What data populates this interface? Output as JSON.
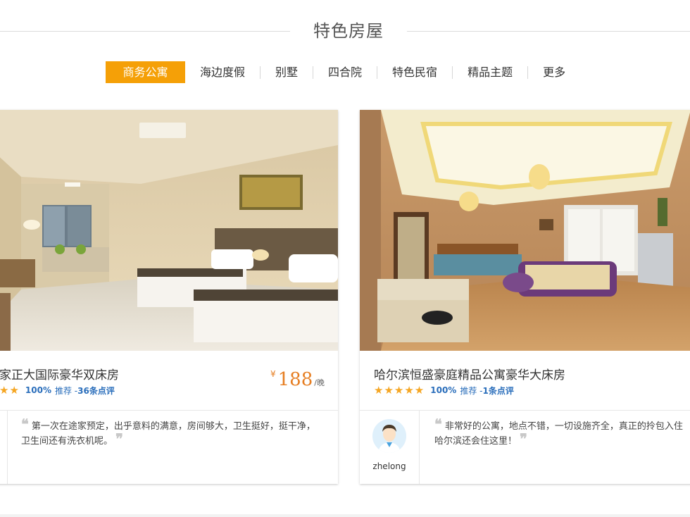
{
  "section": {
    "title": "特色房屋"
  },
  "tabs": [
    {
      "label": "商务公寓",
      "active": true
    },
    {
      "label": "海边度假",
      "active": false
    },
    {
      "label": "别墅",
      "active": false
    },
    {
      "label": "四合院",
      "active": false
    },
    {
      "label": "特色民宿",
      "active": false
    },
    {
      "label": "精品主题",
      "active": false
    },
    {
      "label": "更多",
      "active": false
    }
  ],
  "listings": [
    {
      "name": "家正大国际豪华双床房",
      "stars": "★★",
      "rating_percent": "100%",
      "recommend_label": "推荐 - ",
      "review_count": "36条点评",
      "currency": "¥",
      "price": "188",
      "unit": "/晚",
      "review_text": "第一次在途家预定，出乎意料的满意，房间够大，卫生挺好，挺干净，卫生间还有洗衣机呢。",
      "quote_open": "❝",
      "quote_close": "❞"
    },
    {
      "name": "哈尔滨恒盛豪庭精品公寓豪华大床房",
      "stars": "★★★★★",
      "rating_percent": "100%",
      "recommend_label": "推荐 - ",
      "review_count": "1条点评",
      "currency": "¥",
      "price": "",
      "unit": "",
      "reviewer": "zhelong",
      "review_text": "非常好的公寓，地点不错，一切设施齐全，真正的拎包入住哈尔滨还会住这里！",
      "quote_open": "❝",
      "quote_close": "❞"
    }
  ],
  "colors": {
    "accent": "#f5a007",
    "price": "#e67e22",
    "link": "#2a6ebb",
    "star": "#f5a623"
  }
}
